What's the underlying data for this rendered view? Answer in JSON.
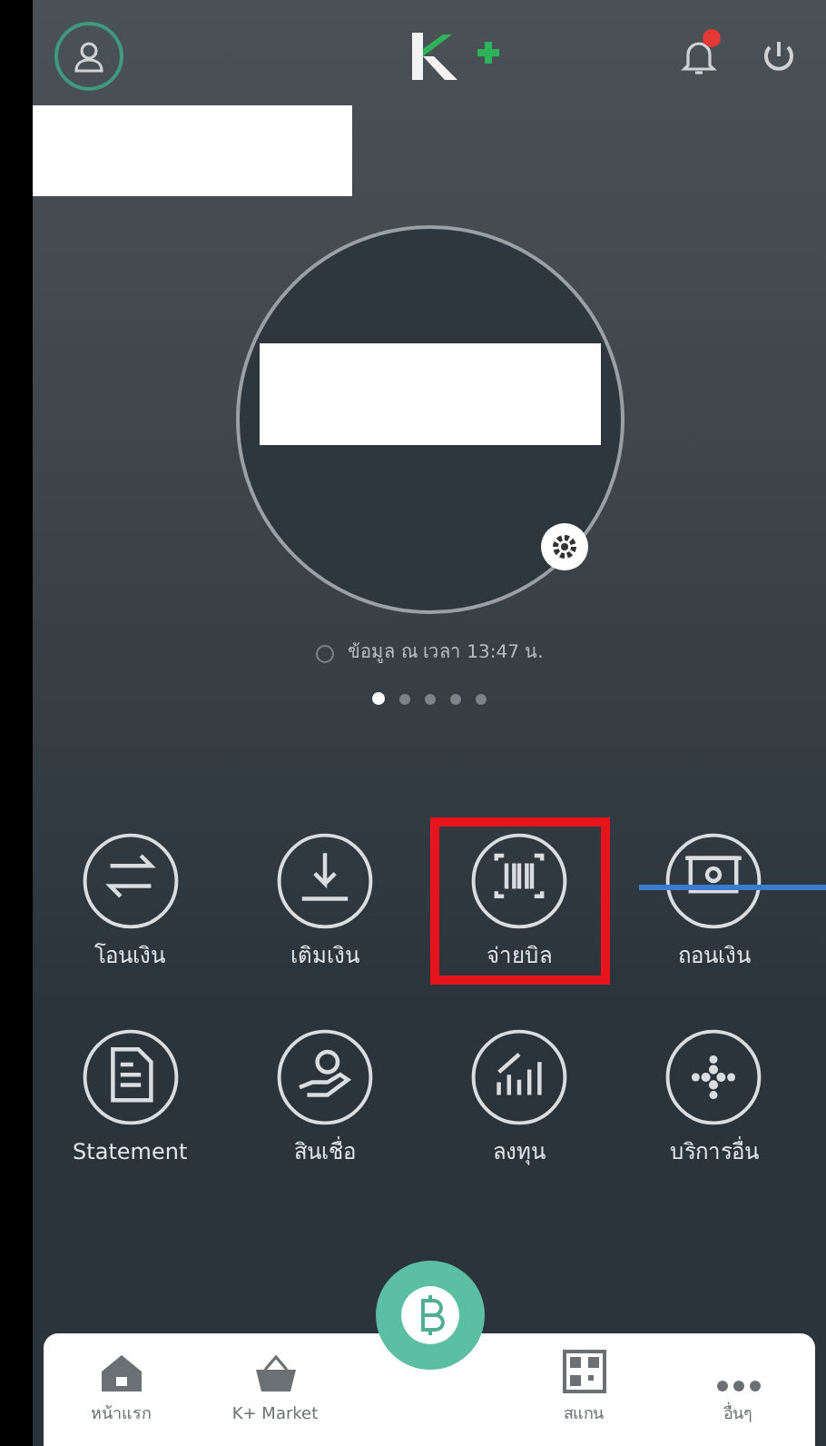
{
  "header": {
    "notification_badge": true
  },
  "balance": {
    "timestamp": "ข้อมูล ณ เวลา 13:47 น."
  },
  "pager": [
    {
      "selected": true
    },
    {
      "selected": false
    },
    {
      "selected": false
    },
    {
      "selected": false
    },
    {
      "selected": false
    }
  ],
  "services": [
    {
      "kind": "transfer",
      "label": "โอนเงิน",
      "highlighted": false
    },
    {
      "kind": "topup",
      "label": "เติมเงิน",
      "highlighted": false
    },
    {
      "kind": "bill",
      "label": "จ่ายบิล",
      "highlighted": true
    },
    {
      "kind": "withdraw",
      "label": "ถอนเงิน",
      "highlighted": false
    },
    {
      "kind": "statement",
      "label": "Statement",
      "highlighted": false
    },
    {
      "kind": "loan",
      "label": "สินเชื่อ",
      "highlighted": false
    },
    {
      "kind": "invest",
      "label": "ลงทุน",
      "highlighted": false
    },
    {
      "kind": "more",
      "label": "บริการอื่น",
      "highlighted": false
    }
  ],
  "bottom_nav": [
    {
      "kind": "home",
      "label": "หน้าแรก"
    },
    {
      "kind": "market",
      "label": "K+ Market"
    },
    {
      "kind": "pay"
    },
    {
      "kind": "scan",
      "label": "สแกน"
    },
    {
      "kind": "more",
      "label": "อื่นๆ"
    }
  ]
}
